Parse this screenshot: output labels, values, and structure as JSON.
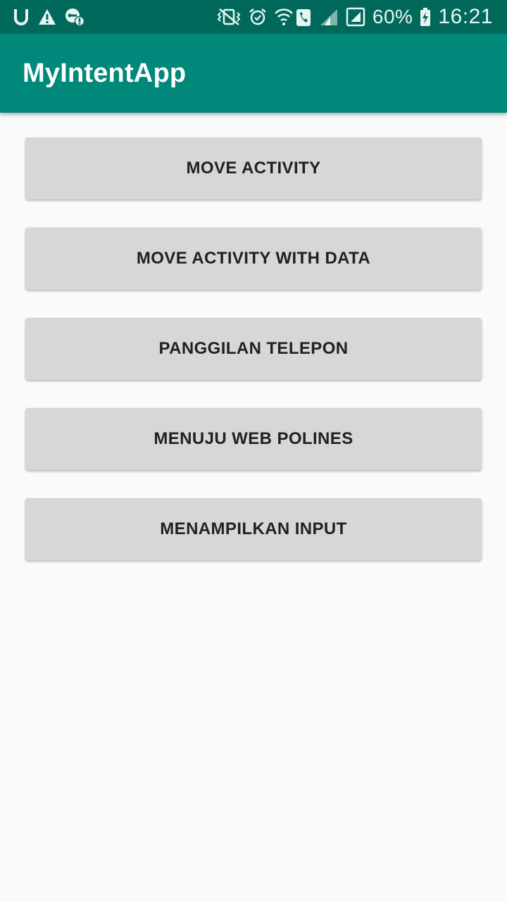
{
  "status_bar": {
    "left_icons": [
      "u-icon",
      "warning-icon",
      "vpn-key-icon"
    ],
    "right_icons": [
      "vibrate-mute-icon",
      "alarm-icon",
      "wifi-call-icon",
      "signal-icon",
      "battery-charging-icon"
    ],
    "battery_percent": "60%",
    "time": "16:21"
  },
  "app_bar": {
    "title": "MyIntentApp",
    "color": "#00897b"
  },
  "buttons": [
    {
      "label": "MOVE ACTIVITY"
    },
    {
      "label": "MOVE ACTIVITY WITH DATA"
    },
    {
      "label": "PANGGILAN TELEPON"
    },
    {
      "label": "MENUJU WEB POLINES"
    },
    {
      "label": "MENAMPILKAN INPUT"
    }
  ],
  "colors": {
    "status_bar": "#00695c",
    "button_background": "#d6d7d7",
    "page_background": "#fafafa"
  }
}
